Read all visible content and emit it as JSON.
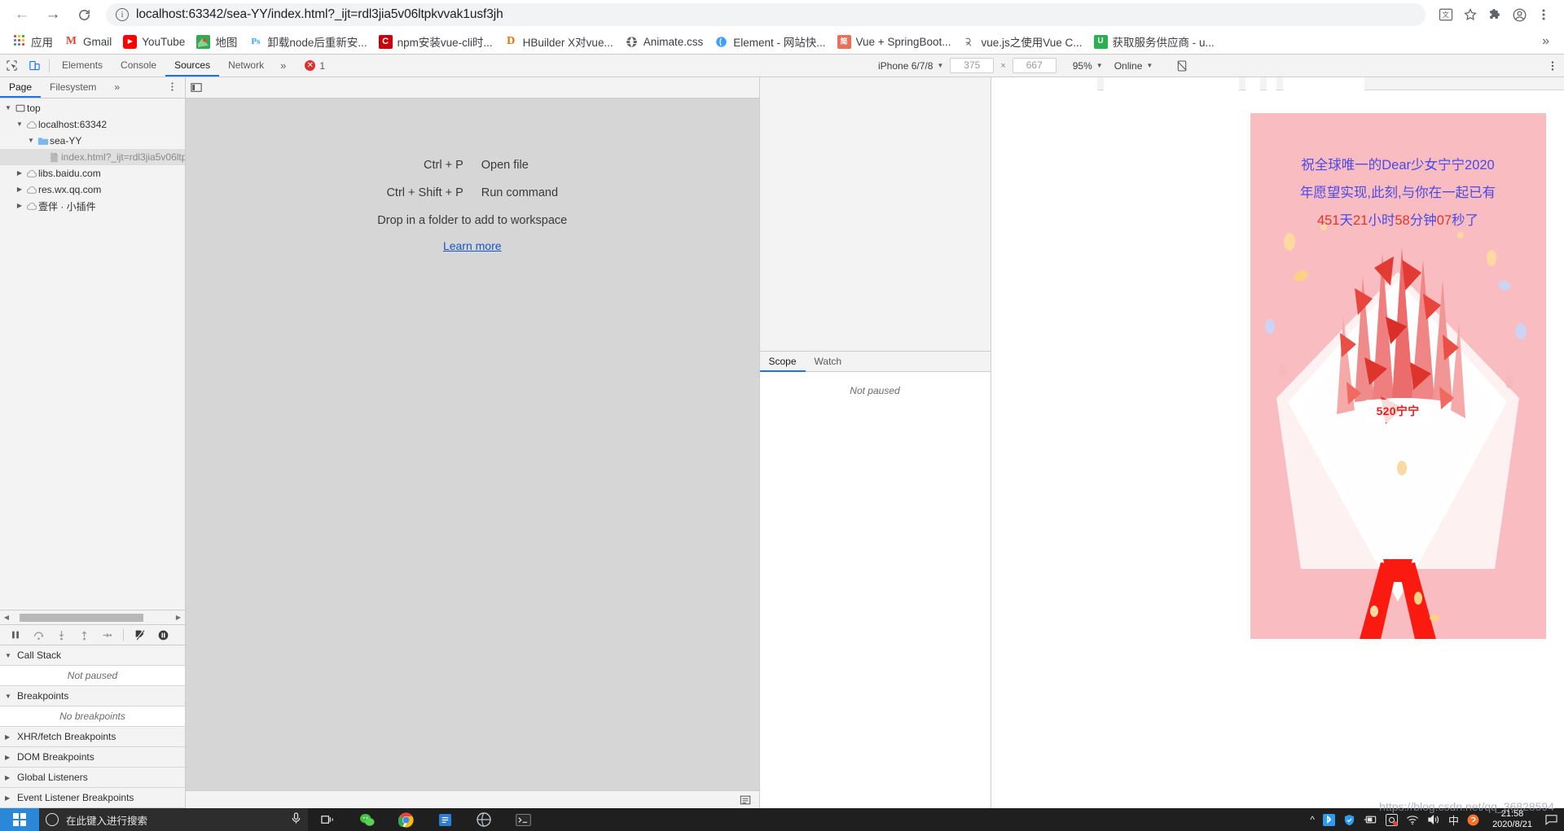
{
  "browser": {
    "url_text": "localhost:63342/sea-YY/index.html?_ijt=rdl3jia5v06ltpkvvak1usf3jh",
    "back_icon": "back-arrow-icon",
    "forward_icon": "forward-arrow-icon",
    "reload_icon": "reload-icon",
    "info_icon": "site-info-icon",
    "toolbar_icons": [
      "translate-icon",
      "bookmark-star-icon",
      "extensions-puzzle-icon",
      "profile-avatar-icon",
      "chrome-menu-icon"
    ],
    "bookmarks": [
      {
        "label": "应用",
        "icon": "apps-grid-icon",
        "color": "#4285f4"
      },
      {
        "label": "Gmail",
        "icon": "gmail-icon",
        "color": "#ea4335"
      },
      {
        "label": "YouTube",
        "icon": "youtube-icon",
        "color": "#ff0000"
      },
      {
        "label": "地图",
        "icon": "google-maps-icon",
        "color": "#34a853"
      },
      {
        "label": "卸载node后重新安...",
        "icon": "photoshop-icon",
        "color": "#31a8ff"
      },
      {
        "label": "npm安装vue-cli时...",
        "icon": "csdn-icon",
        "color": "#c7000b"
      },
      {
        "label": "HBuilder X对vue...",
        "icon": "hbuilder-icon",
        "color": "#f56a00"
      },
      {
        "label": "Animate.css",
        "icon": "globe-icon",
        "color": "#5f6368"
      },
      {
        "label": "Element - 网站快...",
        "icon": "element-ui-icon",
        "color": "#409eff"
      },
      {
        "label": "Vue + SpringBoot...",
        "icon": "jianshu-icon",
        "color": "#ea6f5a"
      },
      {
        "label": "vue.js之使用Vue C...",
        "icon": "bird-icon",
        "color": "#5f6368"
      },
      {
        "label": "获取服务供应商 - u...",
        "icon": "uniapp-icon",
        "color": "#2bb152"
      }
    ],
    "bookmark_overflow": "»"
  },
  "devtools": {
    "inspect_icon": "inspect-element-icon",
    "device_toggle_icon": "toggle-device-toolbar-icon",
    "tabs": [
      {
        "label": "Elements",
        "active": false
      },
      {
        "label": "Console",
        "active": false
      },
      {
        "label": "Sources",
        "active": true
      },
      {
        "label": "Network",
        "active": false
      }
    ],
    "tabs_overflow": "»",
    "error_count": "1",
    "settings_icon": "settings-gear-icon",
    "more_icon": "more-vertical-icon",
    "close_icon": "close-devtools-icon",
    "device": {
      "device_name": "iPhone 6/7/8",
      "width": "375",
      "height": "667",
      "dimension_separator": "×",
      "zoom": "95%",
      "throttling": "Online",
      "rotate_icon": "rotate-device-icon",
      "device_more_icon": "device-more-options-icon"
    },
    "navigator": {
      "tabs": [
        {
          "label": "Page",
          "active": true
        },
        {
          "label": "Filesystem",
          "active": false
        }
      ],
      "tabs_overflow": "»",
      "more_icon": "navigator-more-icon",
      "tree": [
        {
          "label": "top",
          "depth": 0,
          "icon": "frame-icon",
          "twisty": "▼",
          "selected": false,
          "muted": false
        },
        {
          "label": "localhost:63342",
          "depth": 1,
          "icon": "cloud-icon",
          "twisty": "▼",
          "selected": false,
          "muted": false
        },
        {
          "label": "sea-YY",
          "depth": 2,
          "icon": "folder-icon",
          "twisty": "▼",
          "selected": false,
          "muted": false
        },
        {
          "label": "index.html?_ijt=rdl3jia5v06ltp",
          "depth": 3,
          "icon": "file-icon",
          "twisty": "",
          "selected": true,
          "muted": true
        },
        {
          "label": "libs.baidu.com",
          "depth": 1,
          "icon": "cloud-icon",
          "twisty": "▶",
          "selected": false,
          "muted": false
        },
        {
          "label": "res.wx.qq.com",
          "depth": 1,
          "icon": "cloud-icon",
          "twisty": "▶",
          "selected": false,
          "muted": false
        },
        {
          "label": "壹伴 · 小插件",
          "depth": 1,
          "icon": "cloud-icon",
          "twisty": "▶",
          "selected": false,
          "muted": false
        }
      ]
    },
    "editor": {
      "show_navigator_icon": "show-navigator-icon",
      "shortcuts": [
        {
          "key": "Ctrl + P",
          "action": "Open file"
        },
        {
          "key": "Ctrl + Shift + P",
          "action": "Run command"
        }
      ],
      "drop_hint": "Drop in a folder to add to workspace",
      "learn_more": "Learn more",
      "format_icon": "pretty-print-icon"
    },
    "debugger": {
      "toolbar_icons": [
        "pause-script-icon",
        "step-over-icon",
        "step-into-icon",
        "step-out-icon",
        "step-icon",
        "deactivate-breakpoints-icon",
        "pause-on-exceptions-icon"
      ],
      "scope_tabs": [
        {
          "label": "Scope",
          "active": true
        },
        {
          "label": "Watch",
          "active": false
        }
      ],
      "scope_empty": "Not paused",
      "sections": [
        {
          "label": "Call Stack",
          "expanded": true,
          "twisty": "▼",
          "empty_text": "Not paused"
        },
        {
          "label": "Breakpoints",
          "expanded": true,
          "twisty": "▼",
          "empty_text": "No breakpoints"
        },
        {
          "label": "XHR/fetch Breakpoints",
          "expanded": false,
          "twisty": "▶",
          "empty_text": ""
        },
        {
          "label": "DOM Breakpoints",
          "expanded": false,
          "twisty": "▶",
          "empty_text": ""
        },
        {
          "label": "Global Listeners",
          "expanded": false,
          "twisty": "▶",
          "empty_text": ""
        },
        {
          "label": "Event Listener Breakpoints",
          "expanded": false,
          "twisty": "▶",
          "empty_text": ""
        }
      ]
    }
  },
  "preview": {
    "message_line1": "祝全球唯一的Dear少女宁宁2020",
    "message_line2": "年愿望实现,此刻,与你在一起已有",
    "countdown": {
      "days": "451",
      "days_unit": "天",
      "hours": "21",
      "hours_unit": "小时",
      "minutes": "58",
      "minutes_unit": "分钟",
      "seconds": "07",
      "seconds_unit": "秒了"
    },
    "name_card": "520宁宁",
    "background_color": "#f9bcc0",
    "text_color": "#4a4ae8",
    "number_color": "#e8332a"
  },
  "taskbar": {
    "start_icon": "windows-start-icon",
    "search_placeholder": "在此键入进行搜索",
    "search_icon": "search-circle-icon",
    "mic_icon": "microphone-icon",
    "apps": [
      {
        "name": "task-view-icon"
      },
      {
        "name": "wechat-icon"
      },
      {
        "name": "chrome-icon"
      },
      {
        "name": "editor-icon"
      },
      {
        "name": "browser-icon"
      },
      {
        "name": "terminal-icon"
      }
    ],
    "tray_icons": [
      "show-hidden-icons-chevron",
      "bluetooth-icon",
      "security-shield-icon",
      "battery-icon",
      "screenshot-icon",
      "wifi-icon",
      "volume-icon",
      "ime-icon",
      "sogou-icon",
      "action-center-icon"
    ],
    "clock_time": "21:58",
    "clock_date": "2020/8/21"
  },
  "watermark": "https://blog.csdn.net/qq_36828594"
}
